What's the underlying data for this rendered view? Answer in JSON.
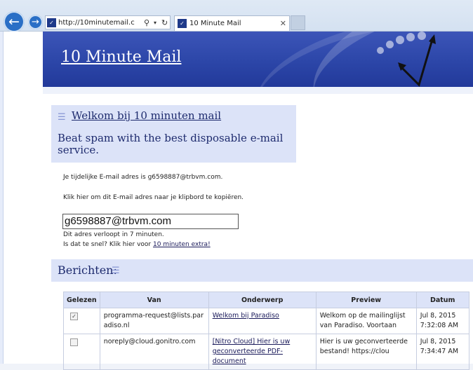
{
  "browser": {
    "address_url": "http://10minutemail.c",
    "tab_title": "10 Minute Mail",
    "icons": {
      "back": "arrow-left-icon",
      "forward": "arrow-right-icon",
      "search": "search-icon",
      "refresh": "refresh-icon",
      "close": "close-icon"
    }
  },
  "banner": {
    "title": "10 Minute Mail"
  },
  "welcome": {
    "heading": "Welkom bij 10 minuten mail",
    "tagline": "Beat spam with the best disposable e-mail service."
  },
  "info": {
    "temp_address_line": "Je tijdelijke E-mail adres is g6598887@trbvm.com.",
    "copy_line": "Klik hier om dit E-mail adres naar je klipbord te kopiëren.",
    "email_value": "g6598887@trbvm.com",
    "expire_line": "Dit adres verloopt in 7 minuten.",
    "extend_prefix": "Is dat te snel? Klik hier voor ",
    "extend_link": "10 minuten extra!"
  },
  "messages": {
    "heading": "Berichten:",
    "columns": [
      "Gelezen",
      "Van",
      "Onderwerp",
      "Preview",
      "Datum"
    ],
    "rows": [
      {
        "read": true,
        "from": "programma-request@lists.paradiso.nl",
        "subject": "Welkom bij Paradiso",
        "preview": "Welkom op de mailinglijst van Paradiso. Voortaan",
        "date": "Jul 8, 2015 7:32:08 AM"
      },
      {
        "read": false,
        "from": "noreply@cloud.gonitro.com",
        "subject": "[Nitro Cloud] Hier is uw geconverteerde PDF-document",
        "preview": "Hier is uw geconverteerde bestand! https://clou",
        "date": "Jul 8, 2015 7:34:47 AM"
      }
    ]
  }
}
